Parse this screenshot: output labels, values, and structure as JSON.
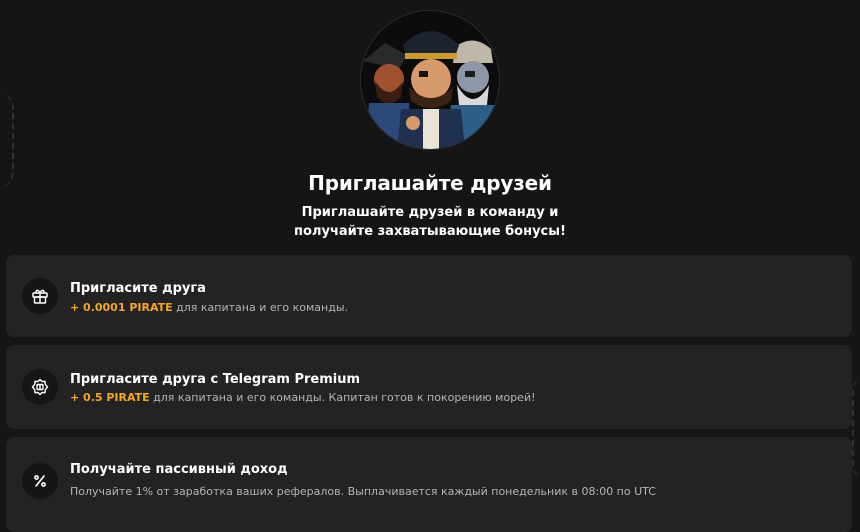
{
  "header": {
    "title": "Приглашайте друзей",
    "subtitle": "Приглашайте друзей в команду и получайте захватывающие бонусы!"
  },
  "cards": [
    {
      "icon": "gift-icon",
      "title": "Пригласите друга",
      "bonus": "+ 0.0001 PIRATE",
      "description": "для капитана и его команды."
    },
    {
      "icon": "premium-badge-icon",
      "title": "Пригласите друга с Telegram Premium",
      "bonus": "+ 0.5 PIRATE",
      "description": "для капитана и его команды. Капитан готов к покорению морей!"
    },
    {
      "icon": "percent-icon",
      "title": "Получайте пассивный доход",
      "description": "Получайте 1% от заработка ваших рефералов. Выплачивается каждый понедельник в 08:00 по UTC"
    }
  ],
  "colors": {
    "background": "#151515",
    "card": "#232323",
    "accent": "#f5a623"
  }
}
